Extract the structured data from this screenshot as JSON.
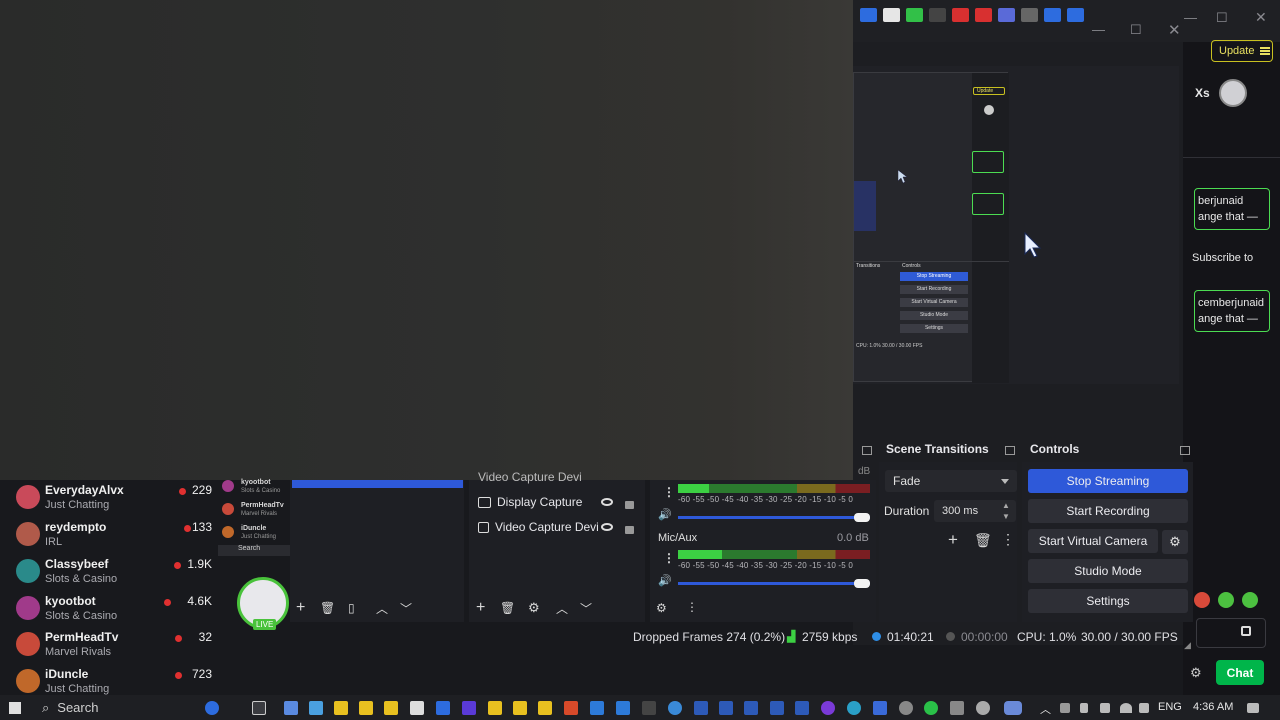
{
  "update_button": {
    "label": "Update"
  },
  "chat_panel": {
    "header_partial": "Xs",
    "messages": [
      {
        "line1": "berjunaid",
        "line2": "ange that —"
      },
      {
        "line1": "cemberjunaid",
        "line2": "ange that —"
      }
    ],
    "subscribe_partial": "Subscribe to",
    "chat_button": "Chat"
  },
  "scene_transitions": {
    "title": "Scene Transitions",
    "selected": "Fade",
    "duration_label": "Duration",
    "duration_value": "300 ms"
  },
  "controls": {
    "title": "Controls",
    "buttons": [
      "Stop Streaming",
      "Start Recording",
      "Start Virtual Camera",
      "Studio Mode",
      "Settings"
    ]
  },
  "sources": [
    {
      "label": "Video Capture Devi"
    },
    {
      "label": "Display Capture"
    },
    {
      "label": "Video Capture Devi"
    }
  ],
  "audio_mixer": {
    "mic_label": "Mic/Aux",
    "mic_db": "0.0 dB",
    "scale": "-60 -55 -50 -45 -40 -35 -30 -25 -20 -15 -10 -5 0",
    "desktop_level": 0.16,
    "mic_level": 0.23
  },
  "status_bar": {
    "dropped_frames": "Dropped Frames 274 (0.2%)",
    "bitrate": "2759 kbps",
    "stream_time": "01:40:21",
    "rec_time": "00:00:00",
    "cpu": "CPU: 1.0%",
    "fps": "30.00 / 30.00 FPS"
  },
  "followed_channels": [
    {
      "name": "EverydayAlvx",
      "category": "Just Chatting",
      "viewers": "229"
    },
    {
      "name": "reydempto",
      "category": "IRL",
      "viewers": "133"
    },
    {
      "name": "Classybeef",
      "category": "Slots & Casino",
      "viewers": "1.9K"
    },
    {
      "name": "kyootbot",
      "category": "Slots & Casino",
      "viewers": "4.6K"
    },
    {
      "name": "PermHeadTv",
      "category": "Marvel Rivals",
      "viewers": "32"
    },
    {
      "name": "iDuncle",
      "category": "Just Chatting",
      "viewers": "723"
    }
  ],
  "mini_followed": [
    {
      "name": "kyootbot",
      "category": "Slots & Casino"
    },
    {
      "name": "PermHeadTv",
      "category": "Marvel Rivals"
    },
    {
      "name": "iDuncle",
      "category": "Just Chatting"
    }
  ],
  "mini_search": "Search",
  "live_badge": "LIVE",
  "taskbar": {
    "search_label": "Search",
    "language": "ENG",
    "time": "4:36 AM"
  },
  "mini_preview_labels": {
    "stop_streaming": "Stop Streaming",
    "start_recording": "Start Recording",
    "start_virtual_camera": "Start Virtual Camera",
    "studio_mode": "Studio Mode",
    "settings": "Settings",
    "transitions": "Transitions",
    "controls": "Controls",
    "update": "Update",
    "stats": "CPU: 1.0%   30.00 / 30.00 FPS"
  }
}
